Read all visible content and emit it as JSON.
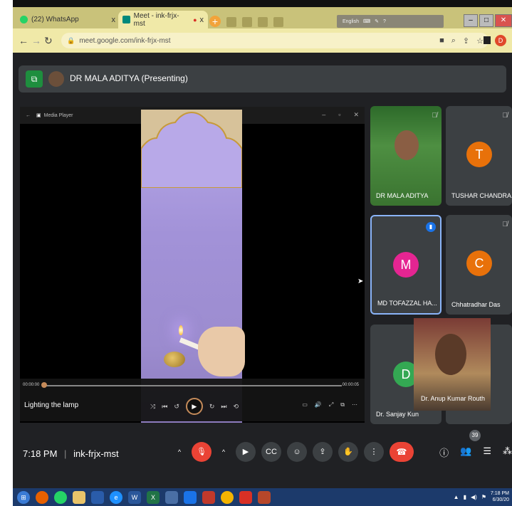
{
  "browser": {
    "tabs": [
      {
        "label": "(22) WhatsApp",
        "close": "x"
      },
      {
        "label": "Meet - ink-frjx-mst",
        "close": "x"
      }
    ],
    "url": "meet.google.com/ink-frjx-mst",
    "lang": "English",
    "profile_initial": "D"
  },
  "meet": {
    "presenting_label": "DR MALA ADITYA (Presenting)",
    "media_player": {
      "window_title": "Media Player",
      "time_start": "00:00:00",
      "time_end": "00:00:05",
      "title": "Lighting the lamp",
      "progress": 0.0
    },
    "tiles": [
      {
        "name": "DR MALA ADITYA",
        "initial": ""
      },
      {
        "name": "TUSHAR CHANDRA...",
        "initial": "T",
        "color": "#e8710a"
      },
      {
        "name": "MD TOFAZZAL HA...",
        "initial": "M",
        "color": "#e52592"
      },
      {
        "name": "Chhatradhar Das",
        "initial": "C",
        "color": "#e8710a"
      },
      {
        "name": "Dr. Sanjay Kun",
        "initial": "D",
        "color": "#34a853"
      },
      {
        "name": "Dr. Anup Kumar Routh",
        "initial": ""
      }
    ],
    "bottom": {
      "time": "7:18 PM",
      "meeting_code": "ink-frjx-mst",
      "participants_count": "39"
    }
  },
  "taskbar": {
    "time": "7:18 PM",
    "date": "6/30/20"
  },
  "colors": {
    "meet_bg": "#202124",
    "tile_bg": "#3c4043",
    "red": "#ea4335",
    "tab_strip": "#c9c27a"
  }
}
